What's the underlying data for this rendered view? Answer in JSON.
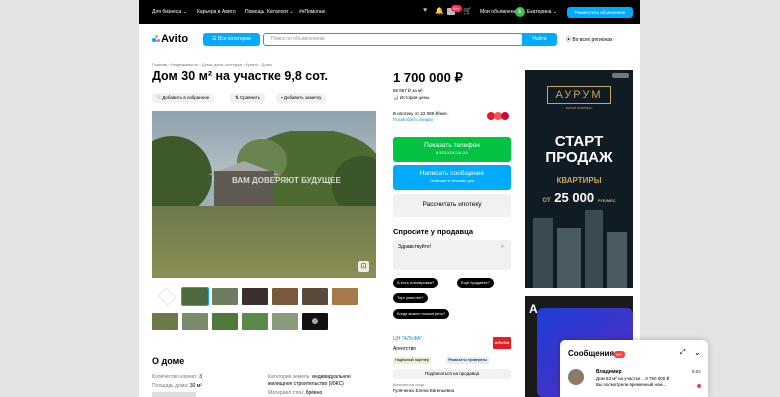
{
  "topbar": {
    "for_business": "Для бизнеса ⌄",
    "career": "Карьера в Авито",
    "help": "Помощь",
    "catalogs": "Каталоги ⌄",
    "charity": "#яПомогаю",
    "badge_count": "99+",
    "my_ads": "Мои объявления",
    "user_initial": "Е",
    "user_name": "Екатерина ⌄",
    "post_ad": "Разместить объявление"
  },
  "header": {
    "logo": "Avito",
    "all_categories": "Все категории",
    "search_placeholder": "Поиск по объявлениям",
    "search_button": "Найти",
    "region": "Во всех регионах"
  },
  "breadcrumbs": "Главная › Недвижимость › Дома, дачи, коттеджи › Купить › Дома",
  "listing": {
    "title": "Дом 30 м² на участке 9,8 сот.",
    "add_favorite": "Добавить в избранное",
    "compare": "Сравнить",
    "add_note": "Добавить заметку",
    "watermark": "ВАМ ДОВЕРЯЮТ БУДУЩЕЕ"
  },
  "about": {
    "title": "О доме",
    "rooms_label": "Количество комнат:",
    "rooms": "3",
    "area_label": "Площадь дома:",
    "area": "30 м²",
    "land_label": "Категория земель:",
    "land": "индивидуальное",
    "land2": "жилищное строительство (ИЖС)",
    "walls_label": "Материал стен:",
    "walls": "брёвно"
  },
  "price": {
    "value": "1 700 000 ₽",
    "per_m2": "56 667 ₽ за м²",
    "history": "История цены",
    "mortgage": "В ипотеку от 22 089 ₽/мес.",
    "discounts": "Посмотреть скидки"
  },
  "buttons": {
    "show_phone": "Показать телефон",
    "phone_masked": "8 923 XXX-XX-XX",
    "write_message": "Написать сообщение",
    "reply_time": "Отвечает в течение дня",
    "calc_mortgage": "Рассчитать ипотеку"
  },
  "ask": {
    "title": "Спросите у продавца",
    "input_value": "Здравствуйте!",
    "chips": [
      "А есть планировка?",
      "Ещё продаёте?",
      "Торг уместен?",
      "Когда можно посмотреть?"
    ]
  },
  "seller": {
    "name": "ЦН \"АЛЬФА\"",
    "type": "Агентство",
    "tag1": "Надёжный партнёр",
    "tag2": "Реквизиты проверены",
    "subscribe": "Подписаться на продавца",
    "contact_label": "Контактное лицо",
    "contact": "Гуляченко Елена Евгеньевна",
    "logo_text": "АЛЬФА"
  },
  "ad1": {
    "brand": "АУРУМ",
    "brand_sub": "ЖИЛОЙ КОМПЛЕКС",
    "head1": "СТАРТ",
    "head2": "ПРОДАЖ",
    "sub": "КВАРТИРЫ",
    "from": "ОТ",
    "price": "25 000",
    "unit": "РУБ/МЕС"
  },
  "ad2": {
    "letter": "A"
  },
  "messages": {
    "title": "Сообщения",
    "count": "99+",
    "name": "Владимир",
    "time": "8:02",
    "preview1": "Дом 63 м² на участке... 3 750 000 ₽",
    "preview2": "Вы посмотрели временный ном..."
  }
}
